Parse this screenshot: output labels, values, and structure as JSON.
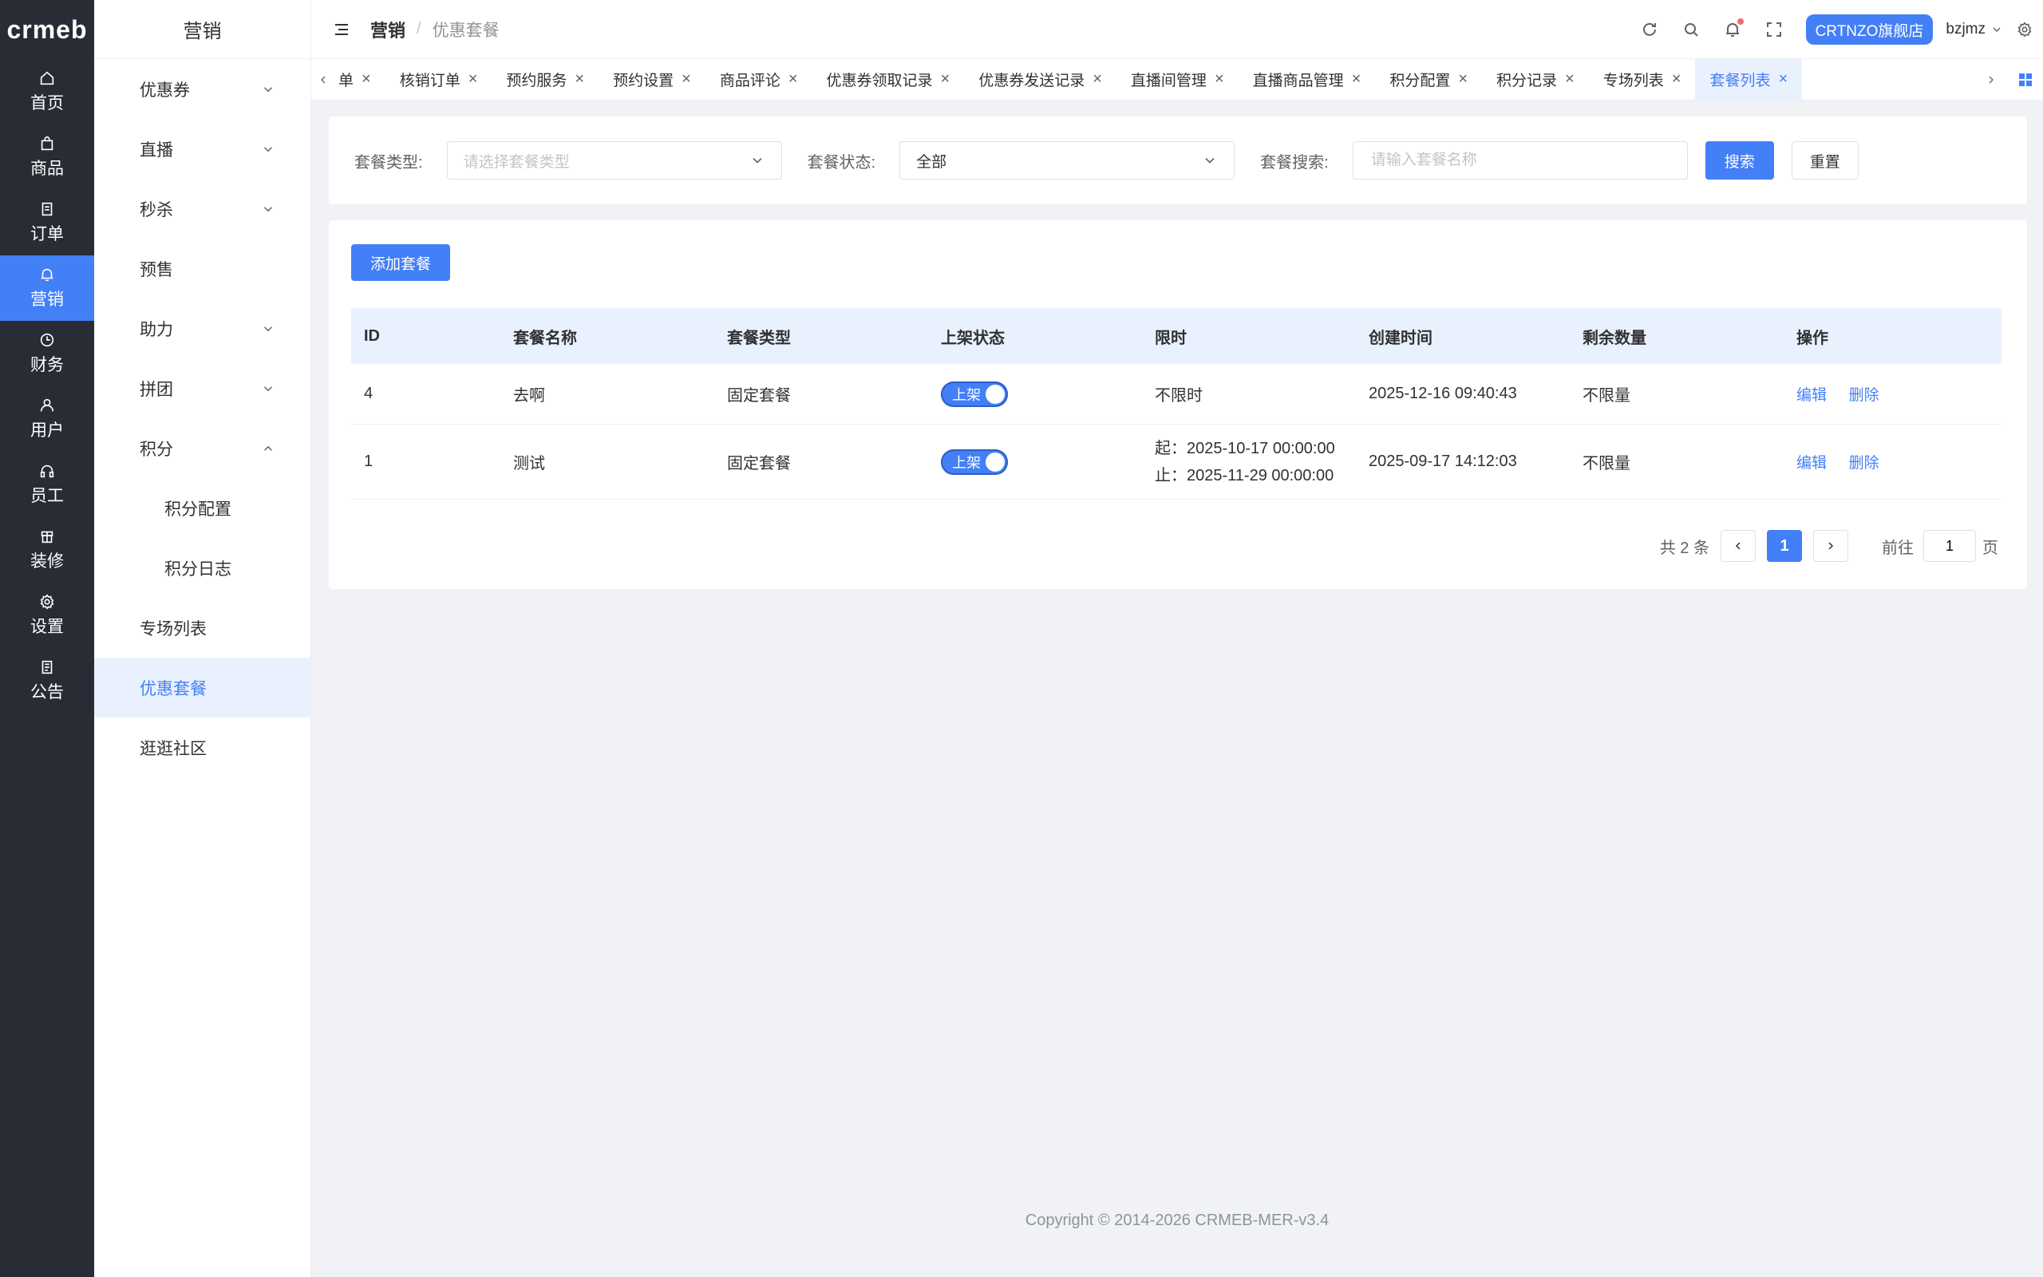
{
  "rail": {
    "logo": "crmeb",
    "items": [
      {
        "label": "首页",
        "icon": "home-icon"
      },
      {
        "label": "商品",
        "icon": "bag-icon"
      },
      {
        "label": "订单",
        "icon": "document-icon"
      },
      {
        "label": "营销",
        "icon": "bell-icon"
      },
      {
        "label": "财务",
        "icon": "clock-icon"
      },
      {
        "label": "用户",
        "icon": "user-icon"
      },
      {
        "label": "员工",
        "icon": "headset-icon"
      },
      {
        "label": "装修",
        "icon": "box-icon"
      },
      {
        "label": "设置",
        "icon": "gear-icon"
      },
      {
        "label": "公告",
        "icon": "notice-icon"
      }
    ]
  },
  "sidebar": {
    "title": "营销",
    "items": [
      {
        "label": "优惠券",
        "arrow": "down"
      },
      {
        "label": "直播",
        "arrow": "down"
      },
      {
        "label": "秒杀",
        "arrow": "down"
      },
      {
        "label": "预售"
      },
      {
        "label": "助力",
        "arrow": "down"
      },
      {
        "label": "拼团",
        "arrow": "down"
      },
      {
        "label": "积分",
        "arrow": "up"
      },
      {
        "label": "积分配置"
      },
      {
        "label": "积分日志"
      },
      {
        "label": "专场列表"
      },
      {
        "label": "优惠套餐"
      },
      {
        "label": "逛逛社区"
      }
    ]
  },
  "header": {
    "crumb_parent": "营销",
    "crumb_sep": "/",
    "crumb_current": "优惠套餐",
    "shop_name": "CRTNZO旗舰店",
    "user_name": "bzjmz"
  },
  "tabs": [
    "单",
    "核销订单",
    "预约服务",
    "预约设置",
    "商品评论",
    "优惠券领取记录",
    "优惠券发送记录",
    "直播间管理",
    "直播商品管理",
    "积分配置",
    "积分记录",
    "专场列表",
    "套餐列表"
  ],
  "filter": {
    "type_label": "套餐类型:",
    "type_placeholder": "请选择套餐类型",
    "status_label": "套餐状态:",
    "status_value": "全部",
    "search_label": "套餐搜索:",
    "search_placeholder": "请输入套餐名称",
    "search_button": "搜索",
    "reset_button": "重置"
  },
  "table": {
    "add_button": "添加套餐",
    "columns": [
      "ID",
      "套餐名称",
      "套餐类型",
      "上架状态",
      "限时",
      "创建时间",
      "剩余数量",
      "操作"
    ],
    "rows": [
      {
        "id": "4",
        "name": "去啊",
        "type": "固定套餐",
        "status": "上架",
        "limit": "不限时",
        "limit_end": "",
        "created": "2025-12-16 09:40:43",
        "remaining": "不限量",
        "edit": "编辑",
        "delete": "删除"
      },
      {
        "id": "1",
        "name": "测试",
        "type": "固定套餐",
        "status": "上架",
        "limit": "起：2025-10-17 00:00:00",
        "limit_end": "止：2025-11-29 00:00:00",
        "created": "2025-09-17 14:12:03",
        "remaining": "不限量",
        "edit": "编辑",
        "delete": "删除"
      }
    ]
  },
  "pagination": {
    "total": "共 2 条",
    "current": "1",
    "goto_label": "前往",
    "goto_value": "1",
    "page_suffix": "页"
  },
  "footer": "Copyright © 2014-2026 CRMEB-MER-v3.4",
  "colors": {
    "accent": "#437ff6",
    "rail_bg": "#282c34",
    "page_bg": "#f0f2f5"
  }
}
